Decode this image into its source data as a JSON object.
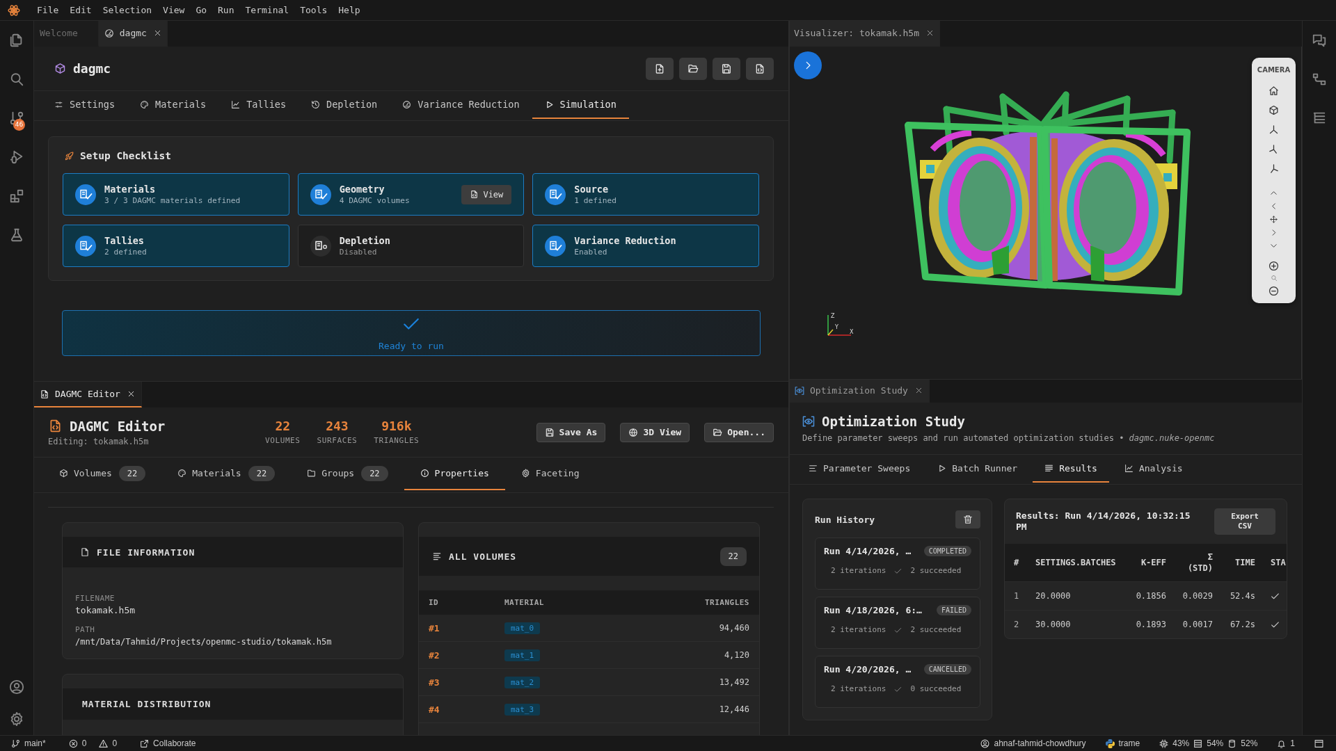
{
  "menu_bar": [
    "File",
    "Edit",
    "Selection",
    "View",
    "Go",
    "Run",
    "Terminal",
    "Tools",
    "Help"
  ],
  "activity_bar": {
    "source_control_badge": "46"
  },
  "editor": {
    "tab_bar": [
      {
        "label": "Welcome",
        "selected": false,
        "focused": false
      },
      {
        "label": "dagmc",
        "selected": true,
        "focused": false
      }
    ],
    "title": "dagmc",
    "nav_tabs": [
      {
        "label": "Settings",
        "selected": false
      },
      {
        "label": "Materials",
        "selected": false
      },
      {
        "label": "Tallies",
        "selected": false
      },
      {
        "label": "Depletion",
        "selected": false
      },
      {
        "label": "Variance Reduction",
        "selected": false
      },
      {
        "label": "Simulation",
        "selected": true
      }
    ],
    "checklist": {
      "title": "Setup Checklist",
      "items": [
        {
          "title": "Materials",
          "detail": "3 / 3 DAGMC materials defined",
          "done": true
        },
        {
          "title": "Geometry",
          "detail": "4 DAGMC volumes",
          "done": true,
          "action": "View"
        },
        {
          "title": "Source",
          "detail": "1 defined",
          "done": true
        },
        {
          "title": "Tallies",
          "detail": "2 defined",
          "done": true
        },
        {
          "title": "Depletion",
          "detail": "Disabled",
          "done": false
        },
        {
          "title": "Variance Reduction",
          "detail": "Enabled",
          "done": true
        }
      ]
    },
    "run_status": {
      "label": "Ready to run",
      "ready": true
    }
  },
  "dagmc_editor": {
    "tab_bar": [
      {
        "label": "DAGMC Editor",
        "selected": true,
        "focused": true
      }
    ],
    "title": "DAGMC Editor",
    "subtitle": "Editing: tokamak.h5m",
    "stats": [
      {
        "value": "22",
        "label": "VOLUMES"
      },
      {
        "value": "243",
        "label": "SURFACES"
      },
      {
        "value": "916k",
        "label": "TRIANGLES"
      }
    ],
    "buttons": [
      "Save As",
      "3D View",
      "Open..."
    ],
    "tabs": [
      {
        "label": "Volumes",
        "count": "22",
        "selected": false
      },
      {
        "label": "Materials",
        "count": "22",
        "selected": false
      },
      {
        "label": "Groups",
        "count": "22",
        "selected": false
      },
      {
        "label": "Properties",
        "selected": true
      },
      {
        "label": "Faceting",
        "selected": false
      }
    ],
    "file_information": {
      "title": "FILE INFORMATION",
      "fields": [
        {
          "label": "FILENAME",
          "value": "tokamak.h5m"
        },
        {
          "label": "PATH",
          "value": "/mnt/Data/Tahmid/Projects/openmc-studio/tokamak.h5m"
        }
      ]
    },
    "material_distribution": {
      "title": "MATERIAL DISTRIBUTION"
    },
    "all_volumes": {
      "title": "ALL VOLUMES",
      "count": "22",
      "columns": [
        "ID",
        "MATERIAL",
        "TRIANGLES"
      ],
      "rows": [
        {
          "id": "#1",
          "material": "mat_0",
          "triangles": "94,460"
        },
        {
          "id": "#2",
          "material": "mat_1",
          "triangles": "4,120"
        },
        {
          "id": "#3",
          "material": "mat_2",
          "triangles": "13,492"
        },
        {
          "id": "#4",
          "material": "mat_3",
          "triangles": "12,446"
        }
      ]
    }
  },
  "visualizer": {
    "tab_bar": [
      {
        "label": "Visualizer: tokamak.h5m",
        "selected": true,
        "focused": false
      }
    ],
    "camera_panel": {
      "title": "CAMERA"
    },
    "axis_labels": [
      "Z",
      "Y",
      "X"
    ]
  },
  "optimization_study": {
    "tab_bar": [
      {
        "label": "Optimization Study",
        "selected": true,
        "focused": false
      }
    ],
    "title": "Optimization Study",
    "description": "Define parameter sweeps and run automated optimization studies • *dagmc.nuke-openmc*",
    "tabs": [
      {
        "label": "Parameter Sweeps",
        "selected": false
      },
      {
        "label": "Batch Runner",
        "selected": false
      },
      {
        "label": "Results",
        "selected": true
      },
      {
        "label": "Analysis",
        "selected": false
      }
    ],
    "run_history": {
      "title": "Run History",
      "runs": [
        {
          "title": "Run 4/14/2026, …",
          "status": "COMPLETED",
          "iterations": "2 iterations",
          "succeeded": "2 succeeded"
        },
        {
          "title": "Run 4/18/2026, 6:…",
          "status": "FAILED",
          "iterations": "2 iterations",
          "succeeded": "2 succeeded"
        },
        {
          "title": "Run 4/20/2026, …",
          "status": "CANCELLED",
          "iterations": "2 iterations",
          "succeeded": "0 succeeded"
        }
      ]
    },
    "results": {
      "title": "Results: Run 4/14/2026, 10:32:15 PM",
      "export_button": "Export CSV",
      "columns": [
        "#",
        "SETTINGS.BATCHES",
        "K-EFF",
        "Σ (STD)",
        "TIME",
        "STA"
      ],
      "rows": [
        {
          "cells": [
            "1",
            "20.0000",
            "0.1856",
            "0.0029",
            "52.4s"
          ],
          "succeeded": true
        },
        {
          "cells": [
            "2",
            "30.0000",
            "0.1893",
            "0.0017",
            "67.2s"
          ],
          "succeeded": true
        }
      ]
    }
  },
  "status_bar": {
    "branch": "main*",
    "errors": "0",
    "warnings": "0",
    "collaborate": "Collaborate",
    "user": "ahnaf-tahmid-chowdhury",
    "environment": "trame",
    "cpu": "43%",
    "memory": "54%",
    "disk": "52%",
    "notifications": "1"
  }
}
